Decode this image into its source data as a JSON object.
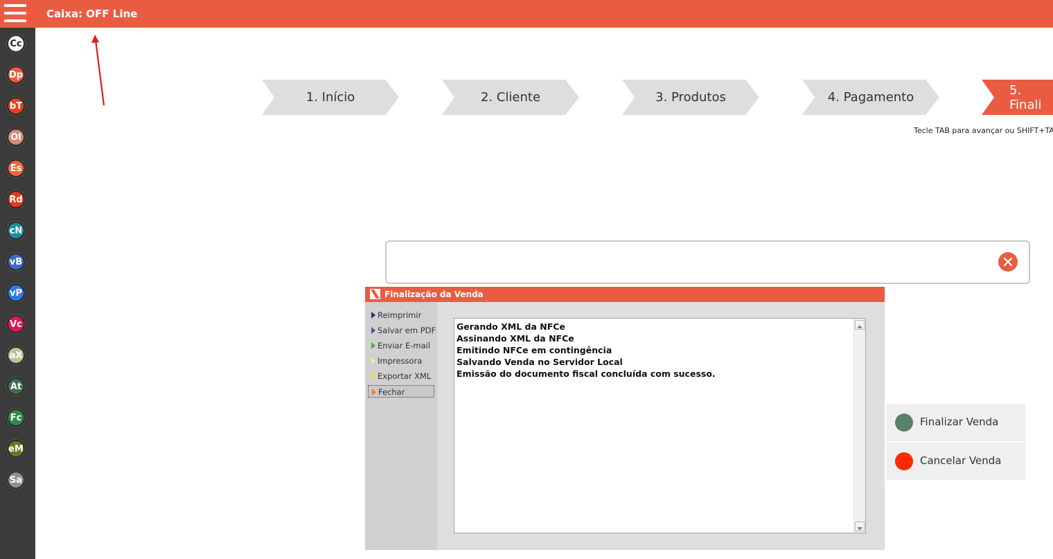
{
  "header": {
    "title": "Caixa: OFF Line"
  },
  "sidebar": {
    "items": [
      {
        "abbr": "Cc",
        "color": "#ffffff",
        "text_color": "#222222"
      },
      {
        "abbr": "Dp",
        "color": "#EA5C42"
      },
      {
        "abbr": "bT",
        "color": "#E5431F"
      },
      {
        "abbr": "Ol",
        "color": "#D48A74"
      },
      {
        "abbr": "Es",
        "color": "#EE6A3B"
      },
      {
        "abbr": "Rd",
        "color": "#E33B1F"
      },
      {
        "abbr": "cN",
        "color": "#1E8FA3"
      },
      {
        "abbr": "vB",
        "color": "#3B6CC7"
      },
      {
        "abbr": "vP",
        "color": "#2F7BE6"
      },
      {
        "abbr": "Vc",
        "color": "#E0145A"
      },
      {
        "abbr": "aX",
        "color": "#B9C59A"
      },
      {
        "abbr": "At",
        "color": "#3F6B4F"
      },
      {
        "abbr": "Fc",
        "color": "#2F8A4C"
      },
      {
        "abbr": "eM",
        "color": "#5E7C1E"
      },
      {
        "abbr": "Sa",
        "color": "#8F8F8F"
      }
    ]
  },
  "steps": [
    {
      "label": "1. Início",
      "active": false
    },
    {
      "label": "2. Cliente",
      "active": false
    },
    {
      "label": "3. Produtos",
      "active": false
    },
    {
      "label": "4. Pagamento",
      "active": false
    },
    {
      "label": "5. Finali",
      "active": true
    }
  ],
  "hint": "Tecle TAB para avançar ou SHIFT+TAB",
  "search": {
    "value": "",
    "placeholder": ""
  },
  "dialog": {
    "title": "Finalização da Venda",
    "menu": [
      {
        "label": "Reimprimir",
        "accent": "#1f3b6e"
      },
      {
        "label": "Salvar em PDF",
        "accent": "#3b5ca8"
      },
      {
        "label": "Enviar E-mail",
        "accent": "#4caf32"
      },
      {
        "label": "Impressora",
        "accent": "#f2ef9a"
      },
      {
        "label": "Exportar XML",
        "accent": "#f2e02c"
      },
      {
        "label": "Fechar",
        "accent": "#f08020"
      }
    ],
    "log": [
      "Gerando XML da NFCe",
      "Assinando XML da NFCe",
      "Emitindo NFCe em contingência",
      "Salvando Venda no Servidor Local",
      "Emissão do documento fiscal concluída com sucesso."
    ]
  },
  "actions": {
    "finalize": {
      "label": "Finalizar Venda",
      "color": "#5A8069"
    },
    "cancel": {
      "label": "Cancelar Venda",
      "color": "#FF2A00"
    }
  },
  "colors": {
    "accent": "#EA5C42",
    "step_inactive": "#DEDEDE"
  }
}
